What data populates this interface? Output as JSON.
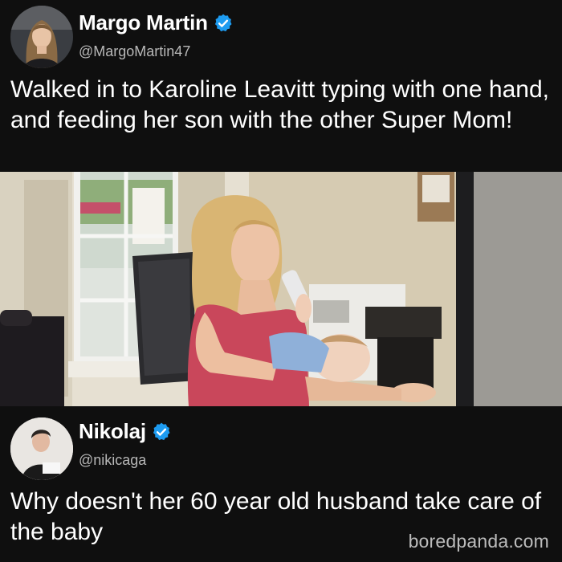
{
  "tweet1": {
    "display_name": "Margo Martin",
    "handle": "@MargoMartin47",
    "text": "Walked in to Karoline Leavitt typing with one hand, and feeding her son with the other Super Mom!",
    "verified": true
  },
  "tweet2": {
    "display_name": "Nikolaj",
    "handle": "@nikicaga",
    "text": "Why doesn't her 60 year old husband take care of the baby",
    "verified": true
  },
  "watermark": "boredpanda.com",
  "colors": {
    "background": "#0f0f0f",
    "verified_badge": "#1d9bf0",
    "handle_text": "#b8b8b8"
  },
  "icons": [
    "verified-badge-icon"
  ]
}
